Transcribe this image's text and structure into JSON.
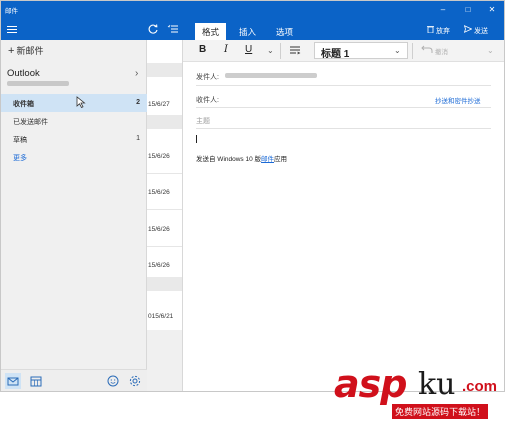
{
  "window": {
    "title": "邮件",
    "controls": {
      "minimize": "–",
      "maximize": "□",
      "close": "✕"
    }
  },
  "left_pane": {
    "new_mail_label": "新邮件",
    "account": {
      "name": "Outlook"
    },
    "folders": [
      {
        "label": "收件箱",
        "count": "2",
        "active": true
      },
      {
        "label": "已发送邮件",
        "count": ""
      },
      {
        "label": "草稿",
        "count": "1"
      },
      {
        "label": "更多",
        "count": ""
      }
    ],
    "bottom_icons": [
      "mail-icon",
      "calendar-icon",
      "smiley-icon",
      "settings-icon"
    ]
  },
  "message_list": {
    "header_icons": [
      "sync-icon",
      "select-mode-icon"
    ],
    "dates": [
      "15/6/27",
      "15/6/26",
      "15/6/26",
      "15/6/26",
      "15/6/26",
      "015/6/21"
    ]
  },
  "ribbon": {
    "tabs": [
      "格式",
      "插入",
      "选项"
    ],
    "active_tab": "格式",
    "discard_label": "放弃",
    "send_label": "发送",
    "format_buttons": {
      "bold": "B",
      "italic": "I",
      "underline": "U"
    },
    "style_value": "标题 1",
    "undo_label": "撤消"
  },
  "compose": {
    "from_label": "发件人:",
    "to_label": "收件人:",
    "cc_bcc_link": "抄送和密件抄送",
    "subject_placeholder": "主题",
    "signature_prefix": "发送自 Windows 10 版",
    "signature_link": "邮件",
    "signature_suffix": "应用"
  },
  "watermark": {
    "brand": "asp",
    "brand_b": "ku",
    "tld": ".com",
    "tagline": "免费网站源码下载站！"
  },
  "colors": {
    "accent": "#0b63c7",
    "selection": "#cfe3f5",
    "link": "#1b6ad6",
    "watermark_red": "#d0101b"
  }
}
